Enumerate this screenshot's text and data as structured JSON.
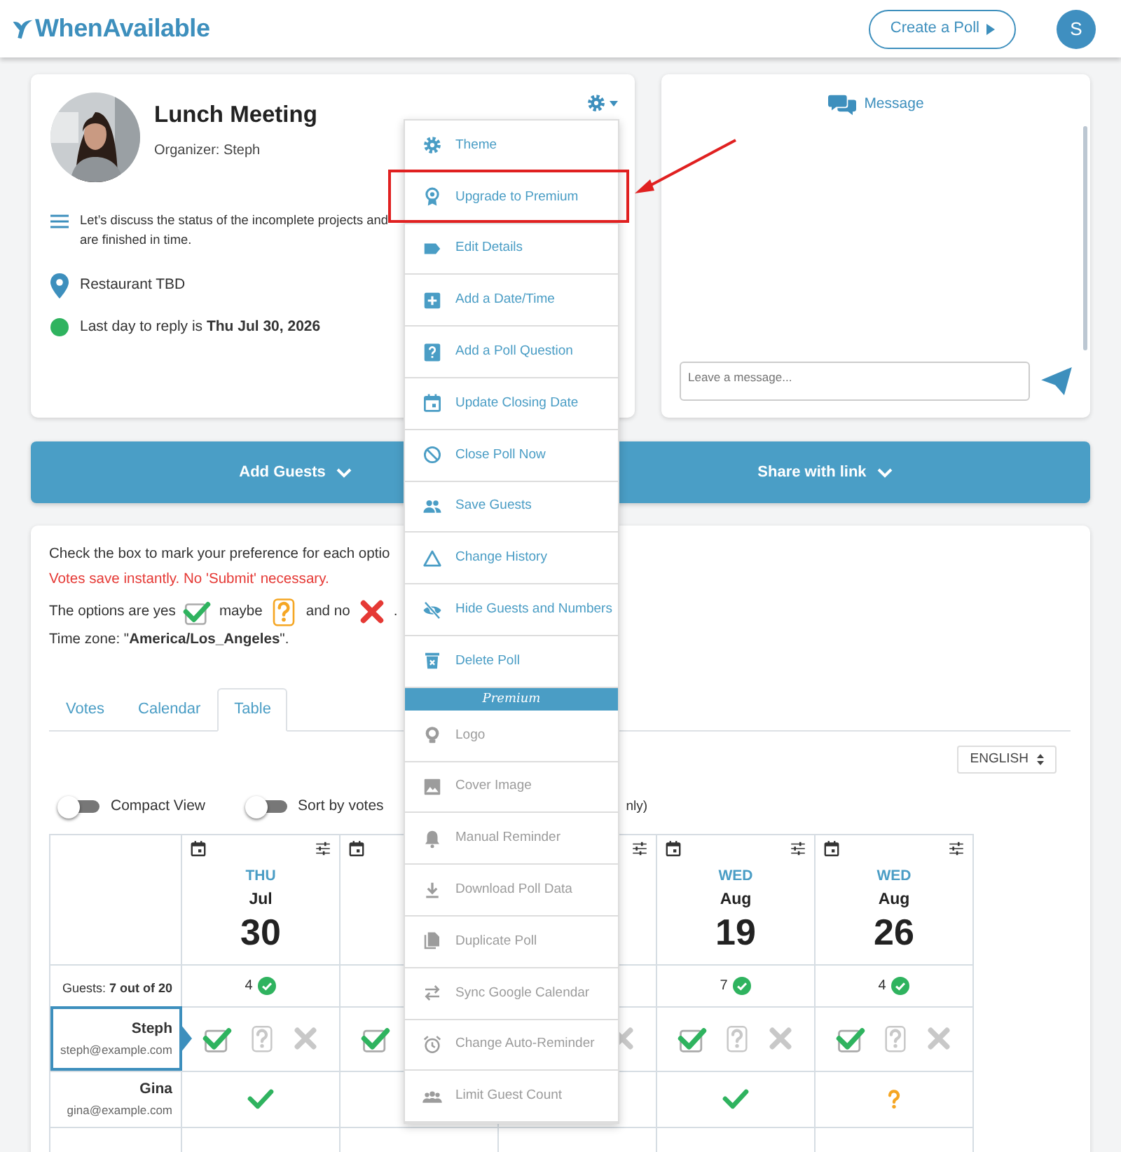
{
  "header": {
    "logo": "WhenAvailable",
    "create_button": "Create a Poll",
    "avatar_initial": "S"
  },
  "event": {
    "title": "Lunch Meeting",
    "organizer": "Organizer: Steph",
    "description_lines": [
      "Let’s discuss the status of the incomplete projects and",
      "are finished in time."
    ],
    "location": "Restaurant TBD",
    "deadline": "Last day to reply is **Thu Jul 30, 2026**"
  },
  "message": {
    "header": "Message",
    "placeholder": "Leave a message..."
  },
  "actions": [
    "Add Guests",
    "Share with link"
  ],
  "instructions": {
    "intro": "Check the box to mark your preference for each optio",
    "warning": "Votes save instantly. No 'Submit' necessary.",
    "options": [
      "The options are  yes",
      "maybe",
      "and no",
      "."
    ],
    "timezone": "Time zone: \"**America/Los_Angeles**\"."
  },
  "tabs": [
    {
      "label": "Votes",
      "selected": false
    },
    {
      "label": "Calendar",
      "selected": false
    },
    {
      "label": "Table",
      "selected": true
    }
  ],
  "language": "ENGLISH",
  "toggles": [
    {
      "label": "Compact View",
      "on": false
    },
    {
      "label": "Sort by votes",
      "on": false
    }
  ],
  "toggles_tail": "nly)",
  "table": {
    "guests_label": "Guests: **7 out of 20**",
    "columns": [
      {
        "kind": "date",
        "weekday": "THU",
        "month": "Jul",
        "day": "30",
        "count": "4"
      },
      {
        "kind": "covered"
      },
      {
        "kind": "covered"
      },
      {
        "kind": "date",
        "weekday": "WED",
        "month": "Aug",
        "day": "19",
        "count": "7"
      },
      {
        "kind": "date",
        "weekday": "WED",
        "month": "Aug",
        "day": "26",
        "count": "4"
      }
    ],
    "rows": [
      {
        "name": "Steph",
        "email": "steph@example.com",
        "selected": true,
        "kind": "editable",
        "cells": [
          {
            "yes": true,
            "maybe": false,
            "no": false
          },
          {
            "yes": true
          },
          {
            "no": false
          },
          {
            "yes": true,
            "maybe": false,
            "no": false
          },
          {
            "yes": true,
            "maybe": false,
            "no": false
          }
        ]
      },
      {
        "name": "Gina",
        "email": "gina@example.com",
        "selected": false,
        "kind": "readonly",
        "cells": [
          {
            "yes": true
          },
          {},
          {},
          {
            "yes": true
          },
          {
            "maybe": true
          }
        ]
      }
    ]
  },
  "menu": [
    {
      "kind": "item",
      "label": "Theme",
      "disabled": false,
      "highlighted": false
    },
    {
      "kind": "item",
      "label": "Upgrade to Premium",
      "disabled": false,
      "highlighted": true
    },
    {
      "kind": "item",
      "label": "Edit Details",
      "disabled": false,
      "highlighted": false
    },
    {
      "kind": "item",
      "label": "Add a Date/Time",
      "disabled": false,
      "highlighted": false
    },
    {
      "kind": "item",
      "label": "Add a Poll Question",
      "disabled": false,
      "highlighted": false
    },
    {
      "kind": "item",
      "label": "Update Closing Date",
      "disabled": false,
      "highlighted": false
    },
    {
      "kind": "item",
      "label": "Close Poll Now",
      "disabled": false,
      "highlighted": false
    },
    {
      "kind": "item",
      "label": "Save Guests",
      "disabled": false,
      "highlighted": false
    },
    {
      "kind": "item",
      "label": "Change History",
      "disabled": false,
      "highlighted": false
    },
    {
      "kind": "item",
      "label": "Hide Guests and Numbers",
      "disabled": false,
      "highlighted": false
    },
    {
      "kind": "item",
      "label": "Delete Poll",
      "disabled": false,
      "highlighted": false
    },
    {
      "kind": "header",
      "label": "Premium"
    },
    {
      "kind": "item",
      "label": "Logo",
      "disabled": true,
      "highlighted": false
    },
    {
      "kind": "item",
      "label": "Cover Image",
      "disabled": true,
      "highlighted": false
    },
    {
      "kind": "item",
      "label": "Manual Reminder",
      "disabled": true,
      "highlighted": false
    },
    {
      "kind": "item",
      "label": "Download Poll Data",
      "disabled": true,
      "highlighted": false
    },
    {
      "kind": "item",
      "label": "Duplicate Poll",
      "disabled": true,
      "highlighted": false
    },
    {
      "kind": "item",
      "label": "Sync Google Calendar",
      "disabled": true,
      "highlighted": false
    },
    {
      "kind": "item",
      "label": "Change Auto-Reminder",
      "disabled": true,
      "highlighted": false
    },
    {
      "kind": "item",
      "label": "Limit Guest Count",
      "disabled": true,
      "highlighted": false
    }
  ]
}
